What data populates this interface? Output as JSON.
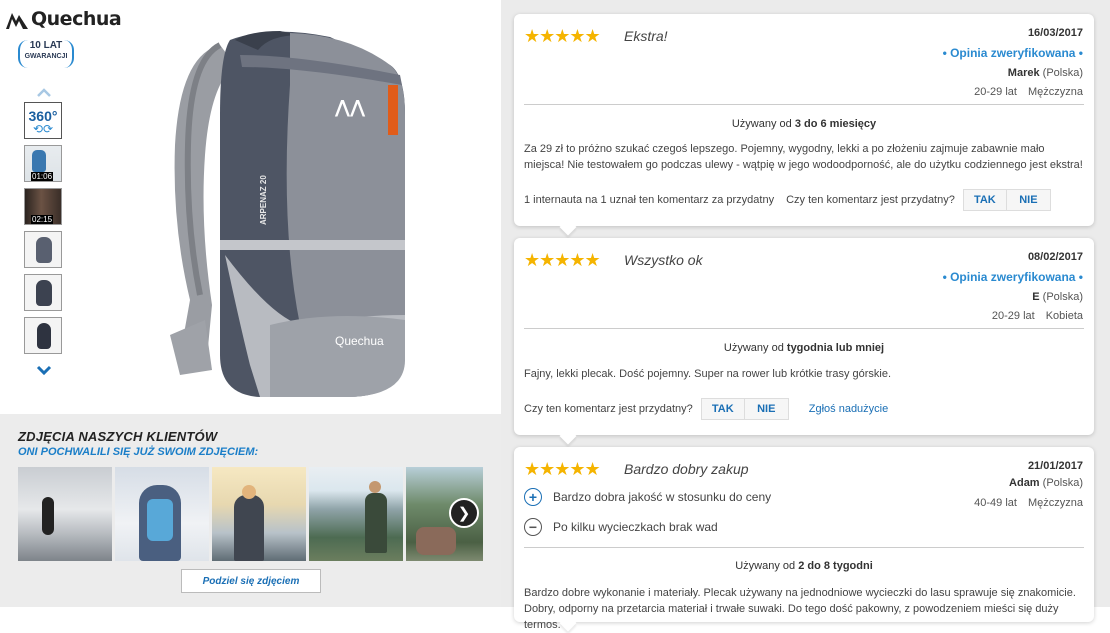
{
  "brand": {
    "name": "Quechua",
    "guarantee_line1": "10 LAT",
    "guarantee_line2": "GWARANCJI"
  },
  "gallery": {
    "thumbs": [
      {
        "type": "360",
        "label": "360°"
      },
      {
        "type": "video",
        "duration": "01:06"
      },
      {
        "type": "video",
        "duration": "02:15"
      },
      {
        "type": "photo"
      },
      {
        "type": "photo"
      },
      {
        "type": "photo"
      }
    ],
    "product_print": "ARPENAZ 20",
    "product_logo_text": "Quechua"
  },
  "customer_photos": {
    "title": "ZDJĘCIA NASZYCH KLIENTÓW",
    "subtitle": "ONI POCHWALILI SIĘ JUŻ SWOIM ZDJĘCIEM:",
    "share_button": "Podziel się zdjęciem"
  },
  "reviews": [
    {
      "stars": "★★★★★",
      "title": "Ekstra!",
      "date": "16/03/2017",
      "verified": "• Opinia zweryfikowana •",
      "name": "Marek",
      "country": "(Polska)",
      "age": "20-29 lat",
      "gender": "Mężczyzna",
      "used_prefix": "Używany od ",
      "used_value": "3 do 6 miesięcy",
      "text": "Za 29 zł to próżno szukać czegoś lepszego. Pojemny, wygodny, lekki a po złożeniu zajmuje zabawnie mało miejsca! Nie testowałem go podczas ulewy - wątpię w jego wodoodporność, ale do użytku codziennego jest ekstra!",
      "helpful_count": "1 internauta na 1 uznał ten komentarz za przydatny",
      "helpful_q": "Czy ten komentarz jest przydatny?",
      "yes": "TAK",
      "no": "NIE"
    },
    {
      "stars": "★★★★★",
      "title": "Wszystko ok",
      "date": "08/02/2017",
      "verified": "• Opinia zweryfikowana •",
      "name": "E",
      "country": "(Polska)",
      "age": "20-29 lat",
      "gender": "Kobieta",
      "used_prefix": "Używany od ",
      "used_value": "tygodnia lub mniej",
      "text": "Fajny, lekki plecak. Dość pojemny. Super na rower lub krótkie trasy górskie.",
      "helpful_q": "Czy ten komentarz jest przydatny?",
      "yes": "TAK",
      "no": "NIE",
      "report": "Zgłoś nadużycie"
    },
    {
      "stars": "★★★★★",
      "title": "Bardzo dobry zakup",
      "date": "21/01/2017",
      "name": "Adam",
      "country": "(Polska)",
      "age": "40-49 lat",
      "gender": "Mężczyzna",
      "pro": "Bardzo dobra jakość w stosunku do ceny",
      "con": "Po kilku wycieczkach brak wad",
      "used_prefix": "Używany od ",
      "used_value": "2 do 8 tygodni",
      "text": "Bardzo dobre wykonanie i materiały. Plecak używany na jednodniowe wycieczki do lasu sprawuje się znakomicie. Dobry, odporny na przetarcia materiał i trwałe suwaki. Do tego dość pakowny, z powodzeniem mieści się duży termos."
    }
  ],
  "colors": {
    "accent": "#2a8ad0",
    "stars": "#f5b400",
    "panel_bg": "#ebebeb"
  }
}
